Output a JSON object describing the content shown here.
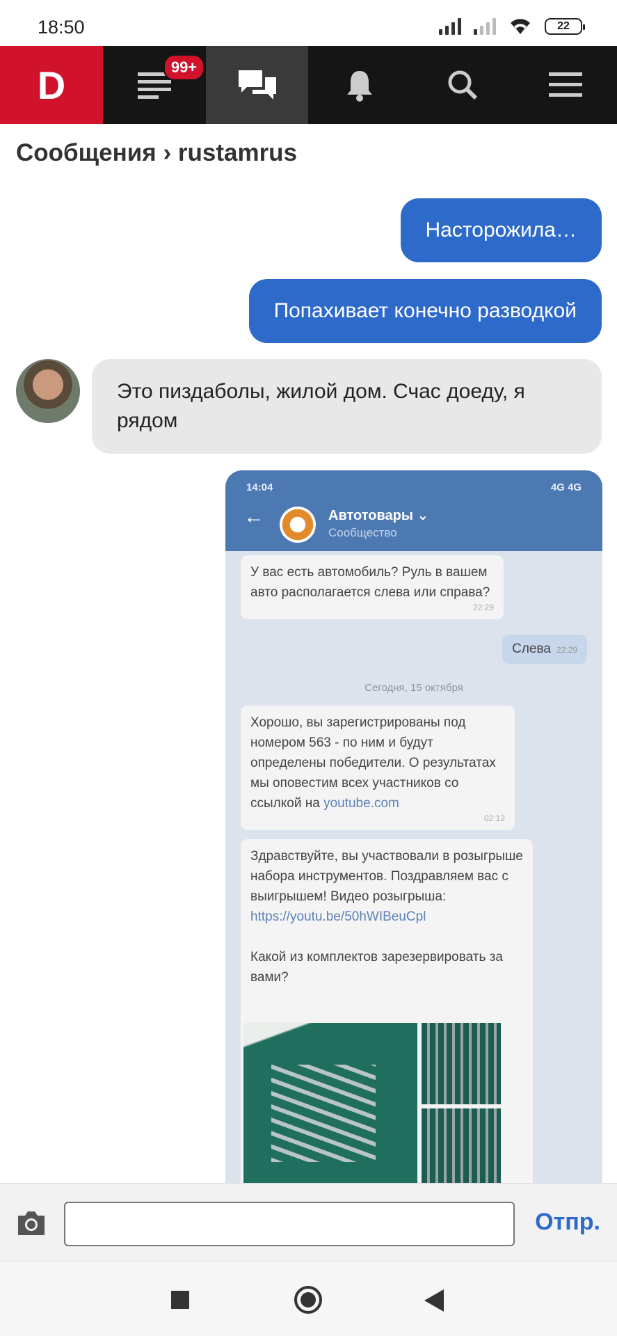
{
  "status_bar": {
    "time": "18:50",
    "battery": "22"
  },
  "nav": {
    "logo": "D",
    "feed_badge": "99+"
  },
  "breadcrumb": {
    "section": "Сообщения",
    "separator": "›",
    "user": "rustamrus"
  },
  "messages": {
    "out1": "Насторожила…",
    "out2": "Попахивает конечно разводкой",
    "in1": "Это пиздаболы, жилой дом. Счас доеду, я рядом"
  },
  "screenshot": {
    "status_time": "14:04",
    "status_right": "4G  4G",
    "header_name": "Автотовары ⌄",
    "header_sub": "Сообщество",
    "msg1": "У вас есть автомобиль? Руль в вашем авто располагается слева или справа?",
    "msg1_time": "22:29",
    "reply": "Слева",
    "reply_time": "22:29",
    "date_divider": "Сегодня, 15 октября",
    "msg2_text": "Хорошо, вы зарегистрированы под номером 563 - по ним и будут определены победители. О результатах мы оповестим всех участников со ссылкой на",
    "msg2_link": "youtube.com",
    "msg2_time": "02:12",
    "msg3_text": "Здравствуйте, вы участвовали в розыгрыше набора инструментов. Поздравляем вас с выигрышем! Видео розыгрыша:",
    "msg3_link": "https://youtu.be/50hWIBeuCpl",
    "msg3_question": "Какой из комплектов зарезервировать за вами?"
  },
  "composer": {
    "input_value": "",
    "send_label": "Отпр."
  },
  "colors": {
    "brand_red": "#d0122a",
    "accent_blue": "#2e6ac9",
    "nav_bg": "#151515"
  }
}
